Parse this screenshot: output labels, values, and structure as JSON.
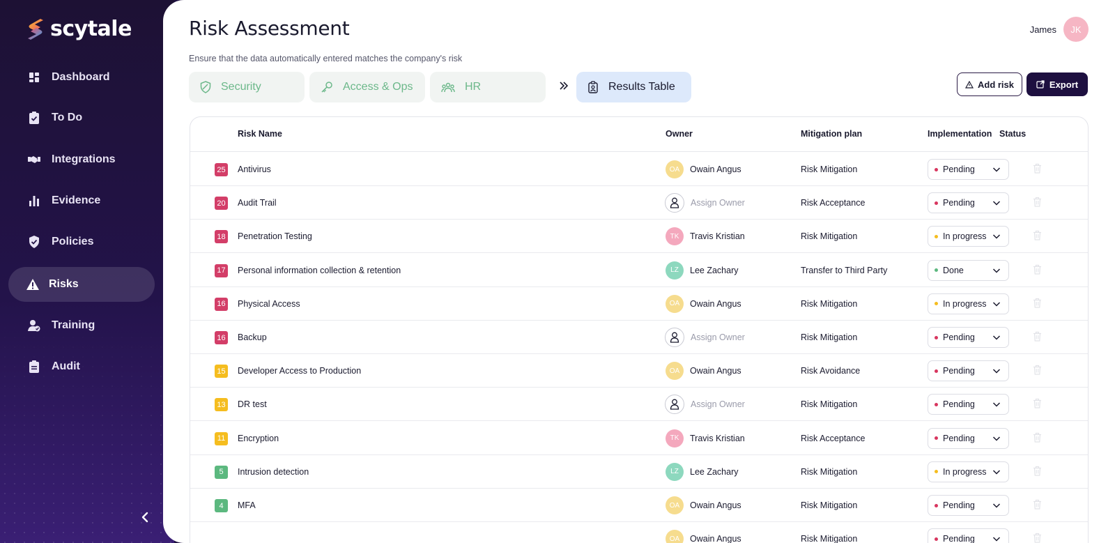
{
  "app": {
    "name": "scytale"
  },
  "colors": {
    "sidebar_bg": "#1e1040",
    "accent_green": "#6cb88a",
    "active_tab": "#dde9fb",
    "score_red": "#d33e68",
    "score_yellow": "#f5bd1f",
    "score_green": "#5cb87f",
    "status_pending": "#d8365f",
    "status_progress": "#f5bd1f",
    "status_done": "#5cb87f"
  },
  "sidebar": {
    "items": [
      {
        "label": "Dashboard",
        "icon": "dashboard-icon"
      },
      {
        "label": "To Do",
        "icon": "clipboard-check-icon"
      },
      {
        "label": "Integrations",
        "icon": "handshake-icon"
      },
      {
        "label": "Evidence",
        "icon": "bar-chart-icon"
      },
      {
        "label": "Policies",
        "icon": "shield-check-icon"
      },
      {
        "label": "Risks",
        "icon": "warning-icon",
        "active": true
      },
      {
        "label": "Training",
        "icon": "user-check-icon"
      },
      {
        "label": "Audit",
        "icon": "clipboard-list-icon"
      }
    ],
    "collapse_icon": "chevron-left-icon"
  },
  "header": {
    "title": "Risk Assessment",
    "subtitle": "Ensure that the data automatically entered matches the company's risk",
    "user": {
      "name": "James",
      "initials": "JK"
    }
  },
  "tabs": [
    {
      "label": "Security",
      "icon": "shield-icon"
    },
    {
      "label": "Access & Ops",
      "icon": "key-icon"
    },
    {
      "label": "HR",
      "icon": "people-icon"
    },
    {
      "label": "Results Table",
      "icon": "badge-icon",
      "active": true
    }
  ],
  "actions": {
    "add_risk": "Add risk",
    "export": "Export"
  },
  "table": {
    "columns": {
      "risk_name": "Risk Name",
      "owner": "Owner",
      "mitigation": "Mitigation plan",
      "implementation": "Implementation",
      "status": "Status"
    },
    "rows": [
      {
        "score": "25",
        "level": "red",
        "name": "Antivirus",
        "owner": "Owain Angus",
        "initials": "OA",
        "av": "yellow",
        "mitigation": "Risk Mitigation",
        "status": "Pending",
        "st": "pending"
      },
      {
        "score": "20",
        "level": "red",
        "name": "Audit Trail",
        "owner": "Assign Owner",
        "initials": "",
        "av": "none",
        "mitigation": "Risk Acceptance",
        "status": "Pending",
        "st": "pending"
      },
      {
        "score": "18",
        "level": "red",
        "name": "Penetration Testing",
        "owner": "Travis Kristian",
        "initials": "TK",
        "av": "pink",
        "mitigation": "Risk Mitigation",
        "status": "In progress",
        "st": "progress"
      },
      {
        "score": "17",
        "level": "red",
        "name": "Personal information collection & retention",
        "owner": "Lee Zachary",
        "initials": "LZ",
        "av": "teal",
        "mitigation": "Transfer to Third Party",
        "status": "Done",
        "st": "done"
      },
      {
        "score": "16",
        "level": "red",
        "name": "Physical Access",
        "owner": "Owain Angus",
        "initials": "OA",
        "av": "yellow",
        "mitigation": "Risk Mitigation",
        "status": "In progress",
        "st": "progress"
      },
      {
        "score": "16",
        "level": "red",
        "name": "Backup",
        "owner": "Assign Owner",
        "initials": "",
        "av": "none",
        "mitigation": "Risk Mitigation",
        "status": "Pending",
        "st": "pending"
      },
      {
        "score": "15",
        "level": "yellow",
        "name": "Developer Access to Production",
        "owner": "Owain Angus",
        "initials": "OA",
        "av": "yellow",
        "mitigation": "Risk Avoidance",
        "status": "Pending",
        "st": "pending"
      },
      {
        "score": "13",
        "level": "yellow",
        "name": "DR test",
        "owner": "Assign Owner",
        "initials": "",
        "av": "none",
        "mitigation": "Risk Mitigation",
        "status": "Pending",
        "st": "pending"
      },
      {
        "score": "11",
        "level": "yellow",
        "name": "Encryption",
        "owner": "Travis Kristian",
        "initials": "TK",
        "av": "pink",
        "mitigation": "Risk Acceptance",
        "status": "Pending",
        "st": "pending"
      },
      {
        "score": "5",
        "level": "green",
        "name": "Intrusion detection",
        "owner": "Lee Zachary",
        "initials": "LZ",
        "av": "teal",
        "mitigation": "Risk Mitigation",
        "status": "In progress",
        "st": "progress"
      },
      {
        "score": "4",
        "level": "green",
        "name": "MFA",
        "owner": "Owain Angus",
        "initials": "OA",
        "av": "yellow",
        "mitigation": "Risk Mitigation",
        "status": "Pending",
        "st": "pending"
      },
      {
        "score": "",
        "level": "green",
        "name": "",
        "owner": "Owain Angus",
        "initials": "OA",
        "av": "yellow",
        "mitigation": "Risk Mitigation",
        "status": "Pending",
        "st": "pending"
      }
    ]
  }
}
